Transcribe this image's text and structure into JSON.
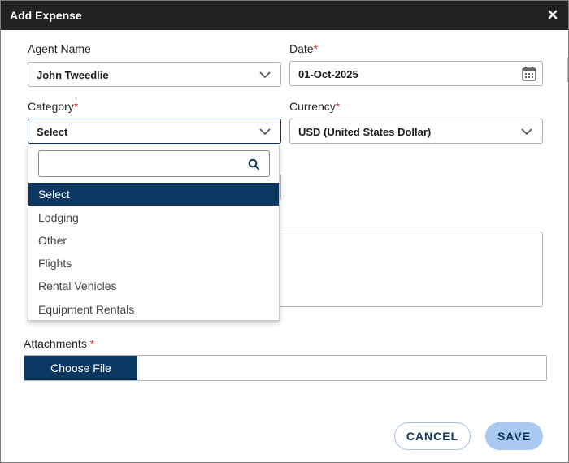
{
  "dialog": {
    "title": "Add Expense"
  },
  "form": {
    "agent_name": {
      "label": "Agent Name",
      "value": "John Tweedlie"
    },
    "date": {
      "label": "Date",
      "required_mark": "*",
      "value": "01-Oct-2025"
    },
    "category": {
      "label": "Category",
      "required_mark": "*",
      "value": "Select"
    },
    "currency": {
      "label": "Currency",
      "required_mark": "*",
      "value": "USD (United States Dollar)"
    },
    "attachments": {
      "label": "Attachments",
      "required_mark": "*",
      "button_label": "Choose File"
    }
  },
  "category_dropdown": {
    "search_value": "",
    "options": [
      "Select",
      "Lodging",
      "Other",
      "Flights",
      "Rental Vehicles",
      "Equipment Rentals"
    ],
    "selected": "Select"
  },
  "actions": {
    "cancel_label": "CANCEL",
    "save_label": "SAVE"
  },
  "colors": {
    "title_bar": "#222222",
    "accent_navy": "#0b3761",
    "save_button": "#a9c9f0",
    "required": "#dd3333"
  },
  "icons": {
    "close": "close-icon",
    "calendar": "calendar-icon",
    "chevron": "chevron-down-icon",
    "search": "search-icon"
  }
}
